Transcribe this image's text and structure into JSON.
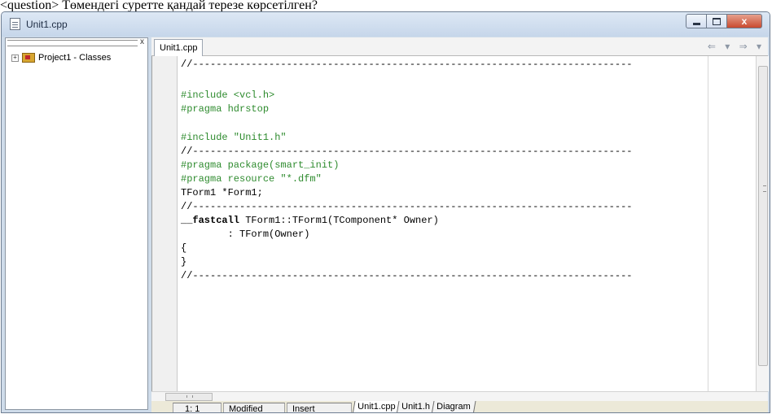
{
  "question": "<question> Төмендегі суретте қандай терезе көрсетілген?",
  "window": {
    "title": "Unit1.cpp",
    "close_glyph": "x"
  },
  "classes": {
    "tree_root": "Project1 - Classes",
    "close_glyph": "x"
  },
  "editor": {
    "tab_label": "Unit1.cpp",
    "nav": "⇐ ▾ ⇒ ▾",
    "code_lines": [
      "//---------------------------------------------------------------------------",
      "#include <vcl.h>",
      "#pragma hdrstop",
      "#include \"Unit1.h\"",
      "//---------------------------------------------------------------------------",
      "#pragma package(smart_init)",
      "#pragma resource \"*.dfm\"",
      "TForm1 *Form1;",
      "//---------------------------------------------------------------------------",
      "__fastcall",
      " TForm1::TForm1(TComponent* Owner)",
      "        : TForm(Owner)",
      "{",
      "}",
      "//---------------------------------------------------------------------------"
    ]
  },
  "status": {
    "position": "1:  1",
    "modified": "Modified",
    "mode": "Insert",
    "tabs": [
      "Unit1.cpp",
      "Unit1.h",
      "Diagram"
    ]
  }
}
